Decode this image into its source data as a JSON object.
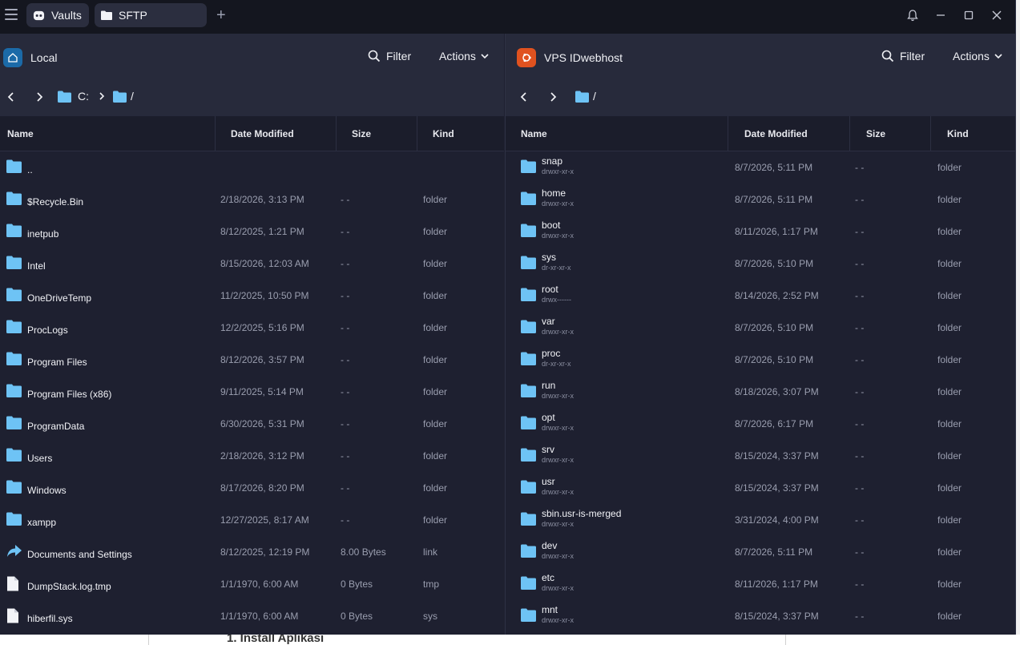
{
  "tabs": [
    {
      "label": "Vaults",
      "icon": "vaults-icon"
    },
    {
      "label": "SFTP",
      "icon": "folder-icon"
    }
  ],
  "colors": {
    "folder": "#6ec3f5",
    "local_icon_bg": "#1b6aa8",
    "remote_icon_bg": "#e0521f"
  },
  "columns": {
    "name": "Name",
    "date": "Date Modified",
    "size": "Size",
    "kind": "Kind"
  },
  "left": {
    "host": "Local",
    "filter": "Filter",
    "actions": "Actions",
    "crumbs": [
      "C:",
      "/"
    ],
    "rows": [
      {
        "name": "..",
        "date": "",
        "size": "",
        "kind": "",
        "icon": "folder"
      },
      {
        "name": "$Recycle.Bin",
        "date": "2/18/2026, 3:13 PM",
        "size": "- -",
        "kind": "folder",
        "icon": "folder"
      },
      {
        "name": "inetpub",
        "date": "8/12/2025, 1:21 PM",
        "size": "- -",
        "kind": "folder",
        "icon": "folder"
      },
      {
        "name": "Intel",
        "date": "8/15/2026, 12:03 AM",
        "size": "- -",
        "kind": "folder",
        "icon": "folder"
      },
      {
        "name": "OneDriveTemp",
        "date": "11/2/2025, 10:50 PM",
        "size": "- -",
        "kind": "folder",
        "icon": "folder"
      },
      {
        "name": "ProcLogs",
        "date": "12/2/2025, 5:16 PM",
        "size": "- -",
        "kind": "folder",
        "icon": "folder"
      },
      {
        "name": "Program Files",
        "date": "8/12/2026, 3:57 PM",
        "size": "- -",
        "kind": "folder",
        "icon": "folder"
      },
      {
        "name": "Program Files (x86)",
        "date": "9/11/2025, 5:14 PM",
        "size": "- -",
        "kind": "folder",
        "icon": "folder"
      },
      {
        "name": "ProgramData",
        "date": "6/30/2026, 5:31 PM",
        "size": "- -",
        "kind": "folder",
        "icon": "folder"
      },
      {
        "name": "Users",
        "date": "2/18/2026, 3:12 PM",
        "size": "- -",
        "kind": "folder",
        "icon": "folder"
      },
      {
        "name": "Windows",
        "date": "8/17/2026, 8:20 PM",
        "size": "- -",
        "kind": "folder",
        "icon": "folder"
      },
      {
        "name": "xampp",
        "date": "12/27/2025, 8:17 AM",
        "size": "- -",
        "kind": "folder",
        "icon": "folder"
      },
      {
        "name": "Documents and Settings",
        "date": "8/12/2025, 12:19 PM",
        "size": "8.00 Bytes",
        "kind": "link",
        "icon": "link"
      },
      {
        "name": "DumpStack.log.tmp",
        "date": "1/1/1970, 6:00 AM",
        "size": "0 Bytes",
        "kind": "tmp",
        "icon": "file"
      },
      {
        "name": "hiberfil.sys",
        "date": "1/1/1970, 6:00 AM",
        "size": "0 Bytes",
        "kind": "sys",
        "icon": "file"
      }
    ]
  },
  "right": {
    "host": "VPS IDwebhost",
    "filter": "Filter",
    "actions": "Actions",
    "crumbs": [
      "/"
    ],
    "rows": [
      {
        "name": "snap",
        "perm": "drwxr-xr-x",
        "date": "8/7/2026, 5:11 PM",
        "size": "- -",
        "kind": "folder"
      },
      {
        "name": "home",
        "perm": "drwxr-xr-x",
        "date": "8/7/2026, 5:11 PM",
        "size": "- -",
        "kind": "folder"
      },
      {
        "name": "boot",
        "perm": "drwxr-xr-x",
        "date": "8/11/2026, 1:17 PM",
        "size": "- -",
        "kind": "folder"
      },
      {
        "name": "sys",
        "perm": "dr-xr-xr-x",
        "date": "8/7/2026, 5:10 PM",
        "size": "- -",
        "kind": "folder"
      },
      {
        "name": "root",
        "perm": "drwx------",
        "date": "8/14/2026, 2:52 PM",
        "size": "- -",
        "kind": "folder"
      },
      {
        "name": "var",
        "perm": "drwxr-xr-x",
        "date": "8/7/2026, 5:10 PM",
        "size": "- -",
        "kind": "folder"
      },
      {
        "name": "proc",
        "perm": "dr-xr-xr-x",
        "date": "8/7/2026, 5:10 PM",
        "size": "- -",
        "kind": "folder"
      },
      {
        "name": "run",
        "perm": "drwxr-xr-x",
        "date": "8/18/2026, 3:07 PM",
        "size": "- -",
        "kind": "folder"
      },
      {
        "name": "opt",
        "perm": "drwxr-xr-x",
        "date": "8/7/2026, 6:17 PM",
        "size": "- -",
        "kind": "folder"
      },
      {
        "name": "srv",
        "perm": "drwxr-xr-x",
        "date": "8/15/2024, 3:37 PM",
        "size": "- -",
        "kind": "folder"
      },
      {
        "name": "usr",
        "perm": "drwxr-xr-x",
        "date": "8/15/2024, 3:37 PM",
        "size": "- -",
        "kind": "folder"
      },
      {
        "name": "sbin.usr-is-merged",
        "perm": "drwxr-xr-x",
        "date": "3/31/2024, 4:00 PM",
        "size": "- -",
        "kind": "folder"
      },
      {
        "name": "dev",
        "perm": "drwxr-xr-x",
        "date": "8/7/2026, 5:11 PM",
        "size": "- -",
        "kind": "folder"
      },
      {
        "name": "etc",
        "perm": "drwxr-xr-x",
        "date": "8/11/2026, 1:17 PM",
        "size": "- -",
        "kind": "folder"
      },
      {
        "name": "mnt",
        "perm": "drwxr-xr-x",
        "date": "8/15/2024, 3:37 PM",
        "size": "- -",
        "kind": "folder"
      }
    ]
  },
  "background_page": {
    "text": "1. Install Aplikasi"
  }
}
